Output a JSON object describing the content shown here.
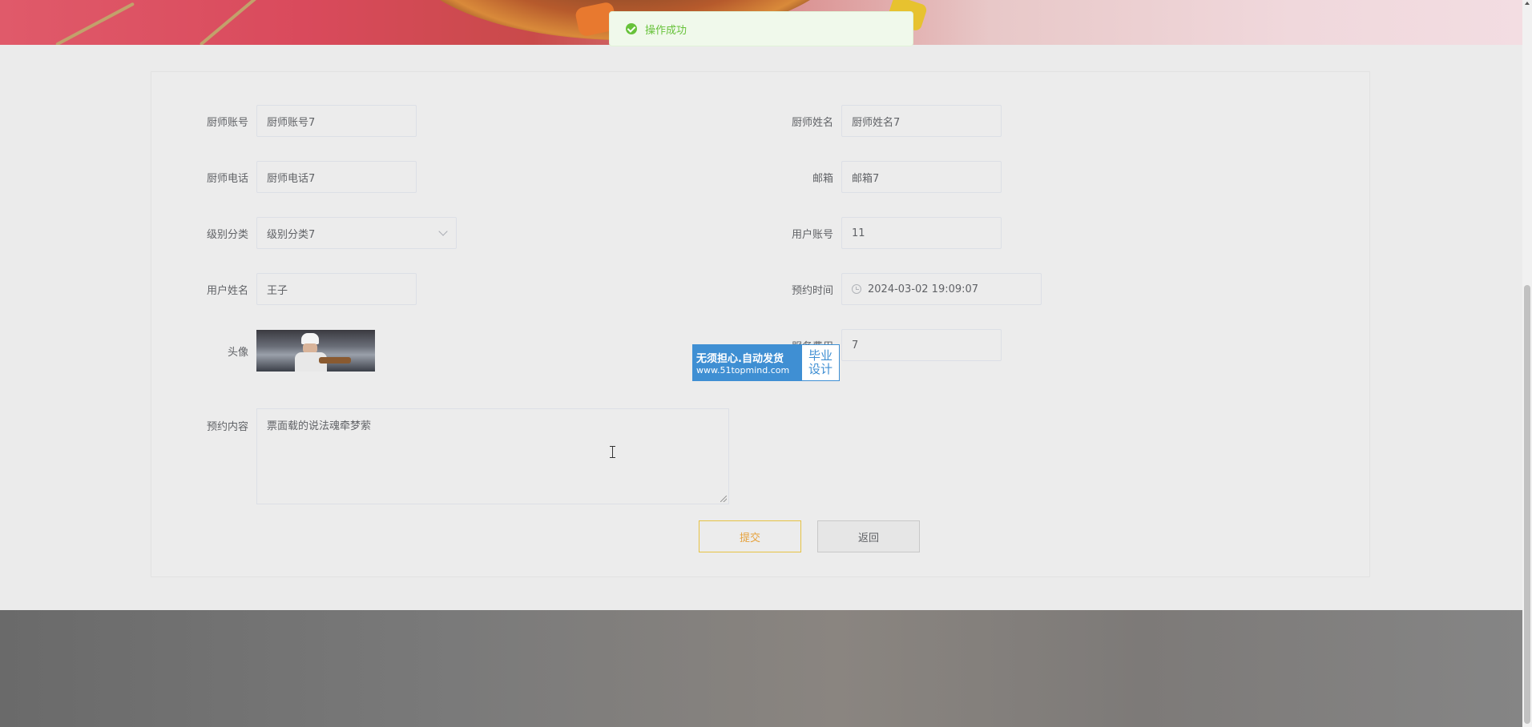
{
  "toast": {
    "message": "操作成功"
  },
  "form": {
    "chef_account": {
      "label": "厨师账号",
      "value": "厨师账号7"
    },
    "chef_name": {
      "label": "厨师姓名",
      "value": "厨师姓名7"
    },
    "chef_phone": {
      "label": "厨师电话",
      "value": "厨师电话7"
    },
    "email": {
      "label": "邮箱",
      "value": "邮箱7"
    },
    "level": {
      "label": "级别分类",
      "value": "级别分类7"
    },
    "user_account": {
      "label": "用户账号",
      "value": "11"
    },
    "user_name": {
      "label": "用户姓名",
      "value": "王子"
    },
    "booking_time": {
      "label": "预约时间",
      "value": "2024-03-02 19:09:07"
    },
    "avatar": {
      "label": "头像"
    },
    "service_fee": {
      "label": "服务费用",
      "value": "7"
    },
    "booking_content": {
      "label": "预约内容",
      "value": "票面载的说法魂牵梦萦"
    }
  },
  "buttons": {
    "submit": "提交",
    "back": "返回"
  },
  "watermark": {
    "title": "无须担心.自动发货",
    "url": "www.51topmind.com",
    "badge_line1": "毕业",
    "badge_line2": "设计"
  },
  "colors": {
    "success": "#67c23a",
    "submit_border": "#e6c244",
    "watermark_blue": "#3f8fd3"
  }
}
